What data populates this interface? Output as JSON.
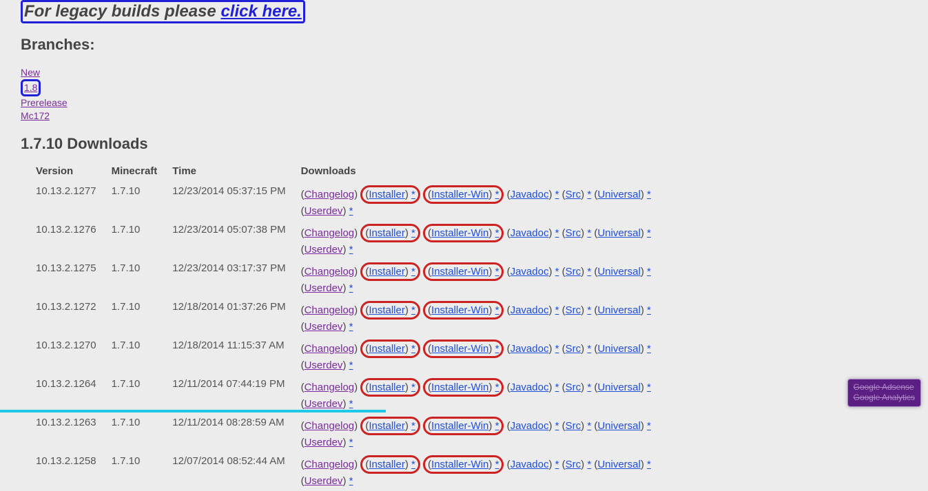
{
  "legacy": {
    "prefix": "For legacy builds please ",
    "link": "click here."
  },
  "branches_heading": "Branches:",
  "branches": {
    "new": "New",
    "v18": "1.8",
    "prerelease": "Prerelease",
    "mc172": "Mc172"
  },
  "downloads_heading": "1.7.10 Downloads",
  "columns": {
    "version": "Version",
    "minecraft": "Minecraft",
    "time": "Time",
    "downloads": "Downloads"
  },
  "rows": [
    {
      "version": "10.13.2.1277",
      "mc": "1.7.10",
      "time": "12/23/2014 05:37:15 PM"
    },
    {
      "version": "10.13.2.1276",
      "mc": "1.7.10",
      "time": "12/23/2014 05:07:38 PM"
    },
    {
      "version": "10.13.2.1275",
      "mc": "1.7.10",
      "time": "12/23/2014 03:17:37 PM"
    },
    {
      "version": "10.13.2.1272",
      "mc": "1.7.10",
      "time": "12/18/2014 01:37:26 PM"
    },
    {
      "version": "10.13.2.1270",
      "mc": "1.7.10",
      "time": "12/18/2014 11:15:37 AM"
    },
    {
      "version": "10.13.2.1264",
      "mc": "1.7.10",
      "time": "12/11/2014 07:44:19 PM"
    },
    {
      "version": "10.13.2.1263",
      "mc": "1.7.10",
      "time": "12/11/2014 08:28:59 AM"
    },
    {
      "version": "10.13.2.1258",
      "mc": "1.7.10",
      "time": "12/07/2014 08:52:44 AM"
    }
  ],
  "dlinks": {
    "changelog": "Changelog",
    "installer": "Installer",
    "installer_win": "Installer-Win",
    "javadoc": "Javadoc",
    "src": "Src",
    "universal": "Universal",
    "userdev": "Userdev",
    "star": "*"
  },
  "ghostery": {
    "line1": "Google Adsense",
    "line2": "Google Analytics"
  }
}
